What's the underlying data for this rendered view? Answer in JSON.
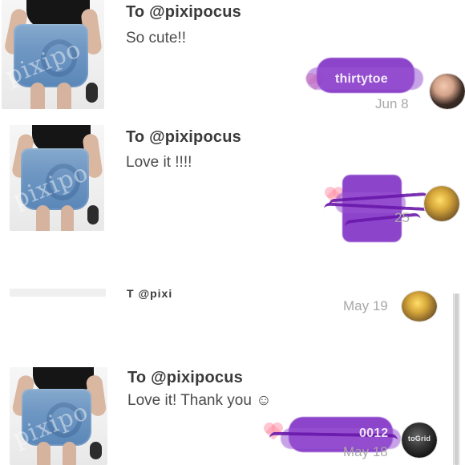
{
  "comments": [
    {
      "to": "To @pixipocus",
      "message": "So cute!!",
      "username": "thirtytoe",
      "date": "Jun 8",
      "thumb_watermark": "pixipo"
    },
    {
      "to": "To @pixipocus",
      "message": "Love it !!!!",
      "username": "",
      "date": "25",
      "thumb_watermark": "pixipo"
    },
    {
      "to": "T    @pixi",
      "message": "",
      "username": "",
      "date": "May 19",
      "thumb_watermark": ""
    },
    {
      "to": "To @pixipocus",
      "message": "Love it! Thank you ☺",
      "username": "0012",
      "date": "May 18",
      "thumb_watermark": "pixipo",
      "avatar_text": "toGrid"
    }
  ],
  "colors": {
    "redaction": "#7c2ac4",
    "date": "#a8a8a8",
    "text": "#3a3a3a"
  }
}
